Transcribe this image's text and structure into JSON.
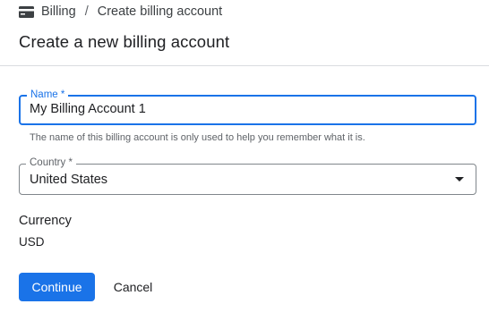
{
  "breadcrumb": {
    "icon": "billing-card-icon",
    "root": "Billing",
    "separator": "/",
    "current": "Create billing account"
  },
  "page": {
    "title": "Create a new billing account"
  },
  "form": {
    "name": {
      "label": "Name *",
      "value": "My Billing Account 1",
      "hint": "The name of this billing account is only used to help you remember what it is."
    },
    "country": {
      "label": "Country *",
      "selected": "United States",
      "icon": "dropdown-arrow-icon"
    },
    "currency": {
      "label": "Currency",
      "value": "USD"
    }
  },
  "actions": {
    "continue_label": "Continue",
    "cancel_label": "Cancel"
  },
  "colors": {
    "accent": "#1a73e8",
    "text": "#202124",
    "muted": "#5f6368",
    "divider": "#dadce0"
  }
}
